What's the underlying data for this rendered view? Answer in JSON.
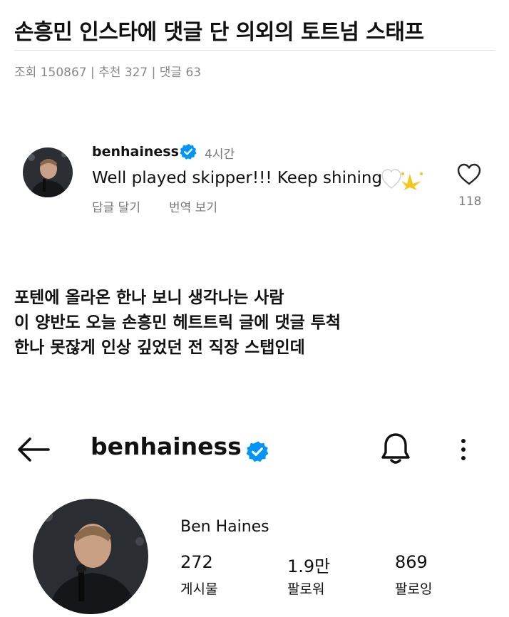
{
  "article": {
    "title": "손흥민 인스타에 댓글 단 의외의 토트넘 스태프",
    "meta": "조회 150867 | 추천 327 | 댓글 63"
  },
  "comment": {
    "username": "benhainess",
    "time": "4시간",
    "text": "Well played skipper!!! Keep shining",
    "reply_label": "답글 달기",
    "translate_label": "번역 보기",
    "like_count": "118",
    "colors": {
      "verified": "#0095f6",
      "emoji_heart": "#ffffff",
      "emoji_star": "#f5c518"
    }
  },
  "body": {
    "lines": [
      "포텐에 올라온 한나 보니 생각나는 사람",
      "이 양반도 오늘 손흥민 헤트트릭 글에 댓글 투척",
      "한나 못잖게 인상 깊었던 전 직장 스탭인데"
    ]
  },
  "profile": {
    "username": "benhainess",
    "name": "Ben Haines",
    "stats": [
      {
        "value": "272",
        "label": "게시물"
      },
      {
        "value": "1.9만",
        "label": "팔로워"
      },
      {
        "value": "869",
        "label": "팔로잉"
      }
    ]
  }
}
